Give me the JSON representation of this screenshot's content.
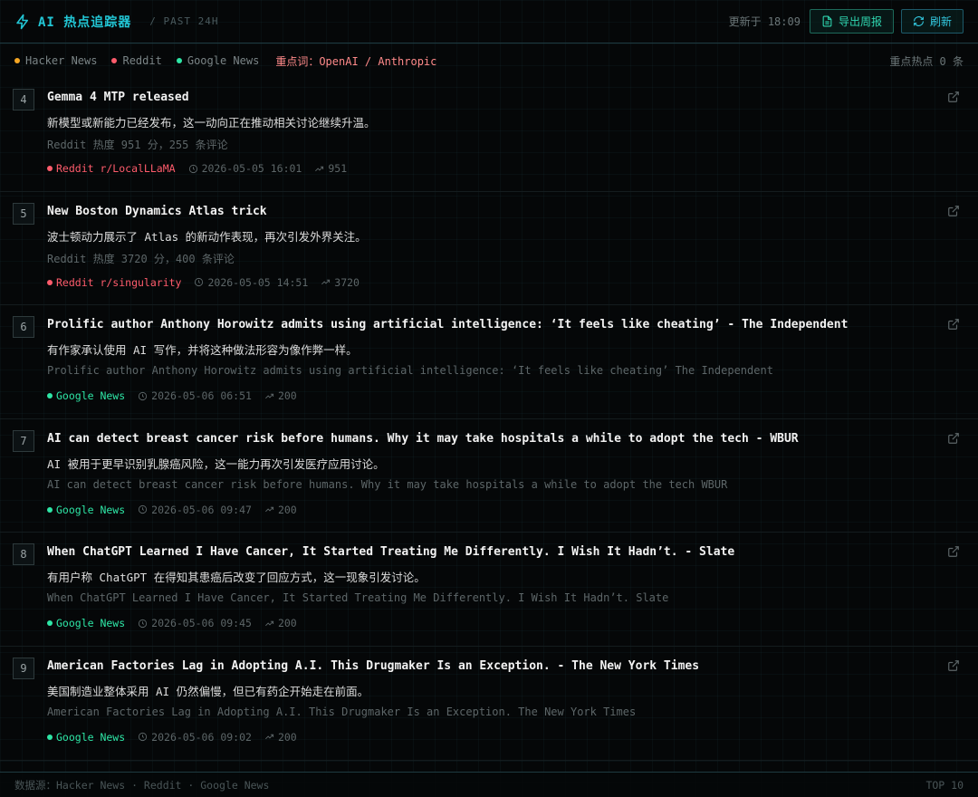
{
  "header": {
    "title": "AI 热点追踪器",
    "subtitle": "/ PAST 24H",
    "updated": "更新于 18:09",
    "export_label": "导出周报",
    "refresh_label": "刷新"
  },
  "filters": {
    "sources": [
      {
        "label": "Hacker News",
        "color": "#f5a623"
      },
      {
        "label": "Reddit",
        "color": "#ff5c6c"
      },
      {
        "label": "Google News",
        "color": "#2ee6a6"
      }
    ],
    "keywords": "重点词：OpenAI / Anthropic",
    "hot_count": "重点热点 0 条"
  },
  "items": [
    {
      "rank": "4",
      "title": "Gemma 4 MTP released",
      "summary": "新模型或新能力已经发布，这一动向正在推动相关讨论继续升温。",
      "detail": "Reddit 热度 951 分，255 条评论",
      "source": "Reddit r/LocalLLaMA",
      "source_color": "#ff5c6c",
      "time": "2026-05-05 16:01",
      "score": "951"
    },
    {
      "rank": "5",
      "title": "New Boston Dynamics Atlas trick",
      "summary": "波士顿动力展示了 Atlas 的新动作表现，再次引发外界关注。",
      "detail": "Reddit 热度 3720 分，400 条评论",
      "source": "Reddit r/singularity",
      "source_color": "#ff5c6c",
      "time": "2026-05-05 14:51",
      "score": "3720"
    },
    {
      "rank": "6",
      "title": "Prolific author Anthony Horowitz admits using artificial intelligence: ‘It feels like cheating’ - The Independent",
      "summary": "有作家承认使用 AI 写作，并将这种做法形容为像作弊一样。",
      "detail": "Prolific author Anthony Horowitz admits using artificial intelligence: ‘It feels like cheating’ The Independent",
      "source": "Google News",
      "source_color": "#2ee6a6",
      "time": "2026-05-06 06:51",
      "score": "200"
    },
    {
      "rank": "7",
      "title": "AI can detect breast cancer risk before humans. Why it may take hospitals a while to adopt the tech - WBUR",
      "summary": "AI 被用于更早识别乳腺癌风险，这一能力再次引发医疗应用讨论。",
      "detail": "AI can detect breast cancer risk before humans. Why it may take hospitals a while to adopt the tech WBUR",
      "source": "Google News",
      "source_color": "#2ee6a6",
      "time": "2026-05-06 09:47",
      "score": "200"
    },
    {
      "rank": "8",
      "title": "When ChatGPT Learned I Have Cancer, It Started Treating Me Differently. I Wish It Hadn’t. - Slate",
      "summary": "有用户称 ChatGPT 在得知其患癌后改变了回应方式，这一现象引发讨论。",
      "detail": "When ChatGPT Learned I Have Cancer, It Started Treating Me Differently. I Wish It Hadn’t. Slate",
      "source": "Google News",
      "source_color": "#2ee6a6",
      "time": "2026-05-06 09:45",
      "score": "200"
    },
    {
      "rank": "9",
      "title": "American Factories Lag in Adopting A.I. This Drugmaker Is an Exception. - The New York Times",
      "summary": "美国制造业整体采用 AI 仍然偏慢，但已有药企开始走在前面。",
      "detail": "American Factories Lag in Adopting A.I. This Drugmaker Is an Exception. The New York Times",
      "source": "Google News",
      "source_color": "#2ee6a6",
      "time": "2026-05-06 09:02",
      "score": "200"
    }
  ],
  "footer": {
    "sources": "数据源：Hacker News · Reddit · Google News",
    "top": "TOP 10"
  }
}
